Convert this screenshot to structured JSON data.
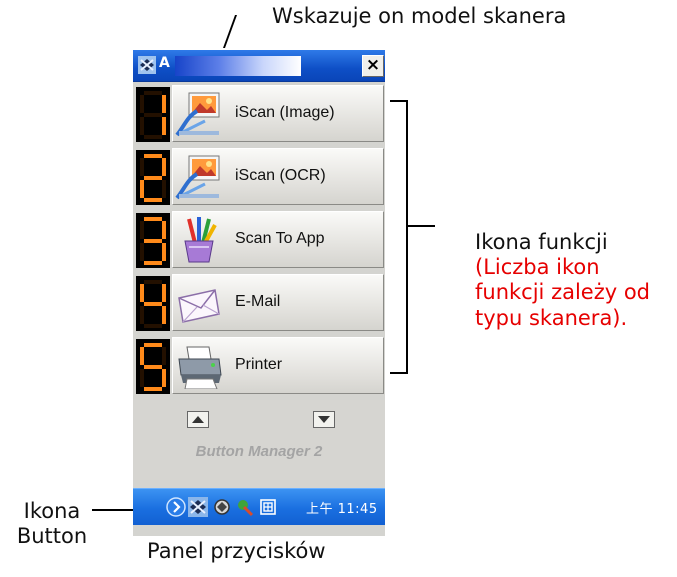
{
  "annotations": {
    "model_indicator": "Wskazuje on model skanera",
    "function_icon": "Ikona funkcji",
    "function_icon_note": "(Liczba ikon funkcji zależy od typu skanera).",
    "function_icon_note_lines": [
      "(Liczba ikon",
      "funkcji zależy od",
      "typu skanera)."
    ],
    "button_icon": "Ikona Button",
    "button_icon_lines": [
      "Ikona",
      "Button"
    ],
    "caption": "Panel przycisków",
    "note_color": "#e60000"
  },
  "panel": {
    "title_letter": "A",
    "close_label": "×",
    "functions": [
      {
        "number": 1,
        "label": "iScan (Image)",
        "icon": "image-scan-icon"
      },
      {
        "number": 2,
        "label": "iScan (OCR)",
        "icon": "ocr-scan-icon"
      },
      {
        "number": 3,
        "label": "Scan To App",
        "icon": "brush-cup-icon"
      },
      {
        "number": 4,
        "label": "E-Mail",
        "icon": "envelope-icon"
      },
      {
        "number": 5,
        "label": "Printer",
        "icon": "printer-icon"
      }
    ],
    "nav": {
      "up": "triangle-up-icon",
      "down": "triangle-down-icon"
    },
    "brand": "Button Manager 2"
  },
  "taskbar": {
    "time": "上午 11:45",
    "icons": [
      "expand-arrow-icon",
      "scanner-tray-icon",
      "tray-icon-2",
      "tray-icon-3",
      "tray-icon-4"
    ]
  },
  "colors": {
    "titlebar": "#0e4fc6",
    "digit": "#ff8a1a",
    "taskbar": "#1a6fe0"
  }
}
